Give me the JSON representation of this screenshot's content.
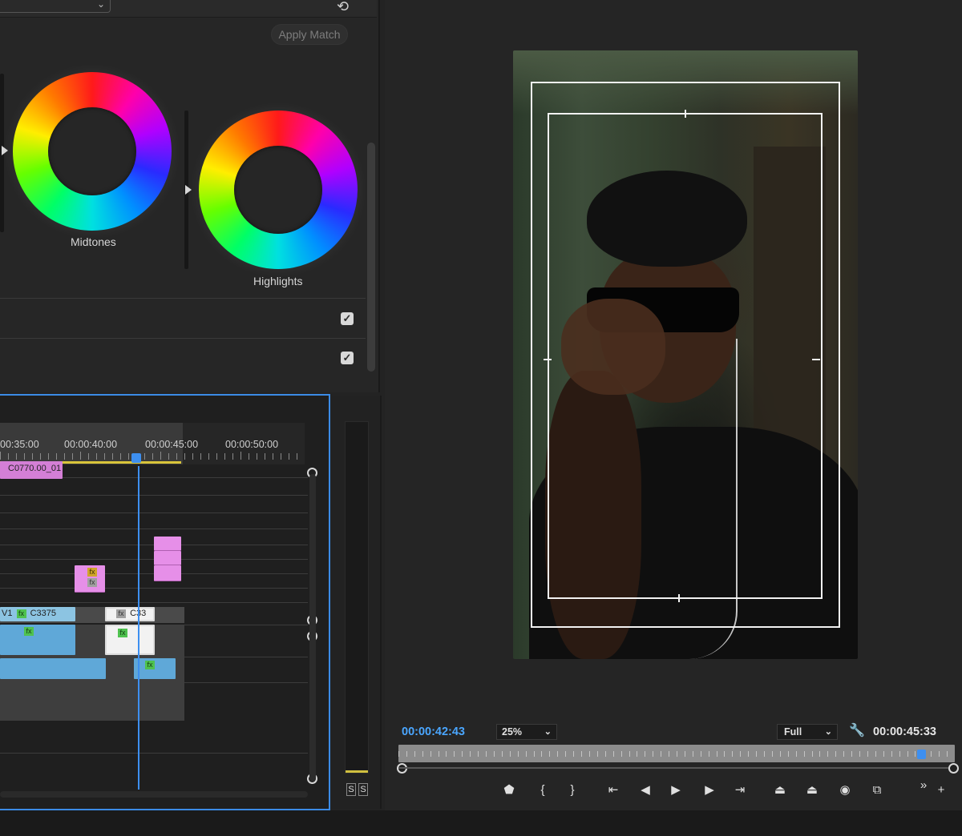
{
  "lumetri": {
    "apply_match_label": "Apply Match",
    "wheels": [
      {
        "label": "Midtones"
      },
      {
        "label": "Highlights"
      }
    ],
    "checkboxes": [
      {
        "checked": true
      },
      {
        "checked": true
      }
    ],
    "reset_icon": "reset-icon",
    "checkmark_glyph": "✓"
  },
  "timeline": {
    "ruler_labels": [
      "00:35:00",
      "00:00:40:00",
      "00:00:45:00",
      "00:00:50:00"
    ],
    "clips": {
      "top_clip": "C0770.00_01",
      "v1_label": "V1",
      "clip_c3375": "C3375",
      "clip_c33": "C33",
      "fx_label": "fx"
    },
    "solo_labels": [
      "S",
      "S"
    ]
  },
  "monitor": {
    "current_time": "00:00:42:43",
    "duration": "00:00:45:33",
    "zoom": "25%",
    "quality": "Full",
    "playhead_fraction": 0.94,
    "controls": [
      "marker-icon",
      "mark-in-icon",
      "mark-out-icon",
      "go-to-in-icon",
      "step-back-icon",
      "play-icon",
      "step-forward-icon",
      "go-to-out-icon",
      "lift-icon",
      "extract-icon",
      "export-frame-icon",
      "compare-view-icon",
      "more-icon",
      "add-button-icon"
    ],
    "control_glyphs": [
      "⬟",
      "{",
      "}",
      "⇤",
      "◀",
      "▶",
      "▶",
      "⇥",
      "⏏",
      "⏏",
      "◉",
      "⧉",
      "»",
      "+"
    ]
  },
  "colors": {
    "accent": "#3d8ff0",
    "timecode_blue": "#4aa6ff",
    "clip_pink": "#d47fd6",
    "clip_blue": "#8cc4e2"
  }
}
